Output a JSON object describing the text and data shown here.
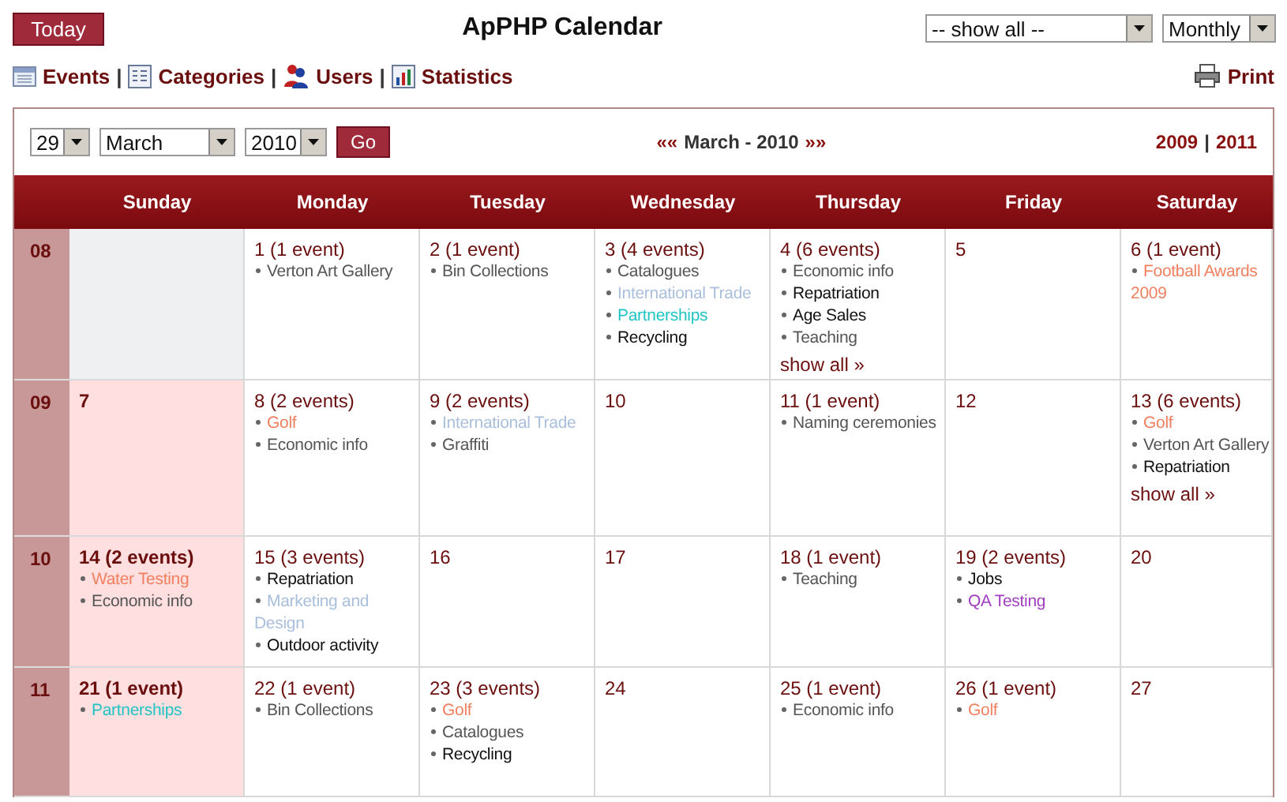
{
  "top": {
    "today_button": "Today",
    "title": "ApPHP Calendar",
    "category_select": "-- show all --",
    "view_select": "Monthly"
  },
  "toolbar": [
    {
      "kind": "link",
      "label": "Events"
    },
    {
      "kind": "separator",
      "text": "|"
    },
    {
      "kind": "link",
      "label": "Categories"
    },
    {
      "kind": "separator",
      "text": "|"
    },
    {
      "kind": "link",
      "label": "Users"
    },
    {
      "kind": "separator",
      "text": "|"
    },
    {
      "kind": "link",
      "label": "Statistics"
    }
  ],
  "print": "Print",
  "nav": {
    "day_select": "29",
    "month_select": "March",
    "year_select": "2010",
    "go_button": "Go",
    "prev": "««",
    "period": "March - 2010",
    "next": "»»",
    "prev_year": "2009",
    "year_separator": "|",
    "next_year": "2011"
  },
  "weekdays": [
    "Sunday",
    "Monday",
    "Tuesday",
    "Wednesday",
    "Thursday",
    "Friday",
    "Saturday"
  ],
  "weeks": [
    {
      "number": "08",
      "days": [
        {
          "kind": "blank"
        },
        {
          "kind": "day",
          "date": "1 (1 event)",
          "events": [
            {
              "title": "Verton Art Gallery",
              "color": "#555555"
            }
          ]
        },
        {
          "kind": "day",
          "date": "2 (1 event)",
          "events": [
            {
              "title": "Bin Collections",
              "color": "#555555"
            }
          ]
        },
        {
          "kind": "day",
          "date": "3 (4 events)",
          "events": [
            {
              "title": "Catalogues",
              "color": "#555555"
            },
            {
              "title": "International Trade",
              "color": "#a9bfdc"
            },
            {
              "title": "Partnerships",
              "color": "#22c4c4"
            },
            {
              "title": "Recycling",
              "color": "#111111"
            }
          ]
        },
        {
          "kind": "day",
          "date": "4 (6 events)",
          "events": [
            {
              "title": "Economic info",
              "color": "#555555"
            },
            {
              "title": "Repatriation",
              "color": "#111111"
            },
            {
              "title": "Age Sales",
              "color": "#111111"
            },
            {
              "title": "Teaching",
              "color": "#555555"
            }
          ],
          "show_all": "show all »"
        },
        {
          "kind": "day",
          "date": "5"
        },
        {
          "kind": "day",
          "date": "6 (1 event)",
          "events": [
            {
              "title": "Football Awards 2009",
              "color": "#f08060"
            }
          ]
        }
      ]
    },
    {
      "number": "09",
      "days": [
        {
          "kind": "day",
          "date": "7"
        },
        {
          "kind": "day",
          "date": "8 (2 events)",
          "events": [
            {
              "title": "Golf",
              "color": "#f08060"
            },
            {
              "title": "Economic info",
              "color": "#555555"
            }
          ]
        },
        {
          "kind": "day",
          "date": "9 (2 events)",
          "events": [
            {
              "title": "International Trade",
              "color": "#a9bfdc"
            },
            {
              "title": "Graffiti",
              "color": "#555555"
            }
          ]
        },
        {
          "kind": "day",
          "date": "10"
        },
        {
          "kind": "day",
          "date": "11 (1 event)",
          "events": [
            {
              "title": "Naming ceremonies",
              "color": "#555555"
            }
          ]
        },
        {
          "kind": "day",
          "date": "12"
        },
        {
          "kind": "day",
          "date": "13 (6 events)",
          "events": [
            {
              "title": "Golf",
              "color": "#f08060"
            },
            {
              "title": "Verton Art Gallery",
              "color": "#555555"
            },
            {
              "title": "Repatriation",
              "color": "#111111"
            }
          ],
          "show_all": "show all »"
        }
      ]
    },
    {
      "number": "10",
      "days": [
        {
          "kind": "day",
          "date": "14 (2 events)",
          "events": [
            {
              "title": "Water Testing",
              "color": "#f08060"
            },
            {
              "title": "Economic info",
              "color": "#555555"
            }
          ]
        },
        {
          "kind": "day",
          "date": "15 (3 events)",
          "events": [
            {
              "title": "Repatriation",
              "color": "#111111"
            },
            {
              "title": "Marketing and Design",
              "color": "#a9bfdc"
            },
            {
              "title": "Outdoor activity",
              "color": "#111111"
            }
          ]
        },
        {
          "kind": "day",
          "date": "16"
        },
        {
          "kind": "day",
          "date": "17"
        },
        {
          "kind": "day",
          "date": "18 (1 event)",
          "events": [
            {
              "title": "Teaching",
              "color": "#555555"
            }
          ]
        },
        {
          "kind": "day",
          "date": "19 (2 events)",
          "events": [
            {
              "title": "Jobs",
              "color": "#111111"
            },
            {
              "title": "QA Testing",
              "color": "#a040c0"
            }
          ]
        },
        {
          "kind": "day",
          "date": "20"
        }
      ]
    },
    {
      "number": "11",
      "days": [
        {
          "kind": "day",
          "date": "21 (1 event)",
          "events": [
            {
              "title": "Partnerships",
              "color": "#22c4c4"
            }
          ]
        },
        {
          "kind": "day",
          "date": "22 (1 event)",
          "events": [
            {
              "title": "Bin Collections",
              "color": "#555555"
            }
          ]
        },
        {
          "kind": "day",
          "date": "23 (3 events)",
          "events": [
            {
              "title": "Golf",
              "color": "#f08060"
            },
            {
              "title": "Catalogues",
              "color": "#555555"
            },
            {
              "title": "Recycling",
              "color": "#111111"
            }
          ]
        },
        {
          "kind": "day",
          "date": "24"
        },
        {
          "kind": "day",
          "date": "25 (1 event)",
          "events": [
            {
              "title": "Economic info",
              "color": "#555555"
            }
          ]
        },
        {
          "kind": "day",
          "date": "26 (1 event)",
          "events": [
            {
              "title": "Golf",
              "color": "#f08060"
            }
          ]
        },
        {
          "kind": "day",
          "date": "27"
        }
      ]
    }
  ]
}
